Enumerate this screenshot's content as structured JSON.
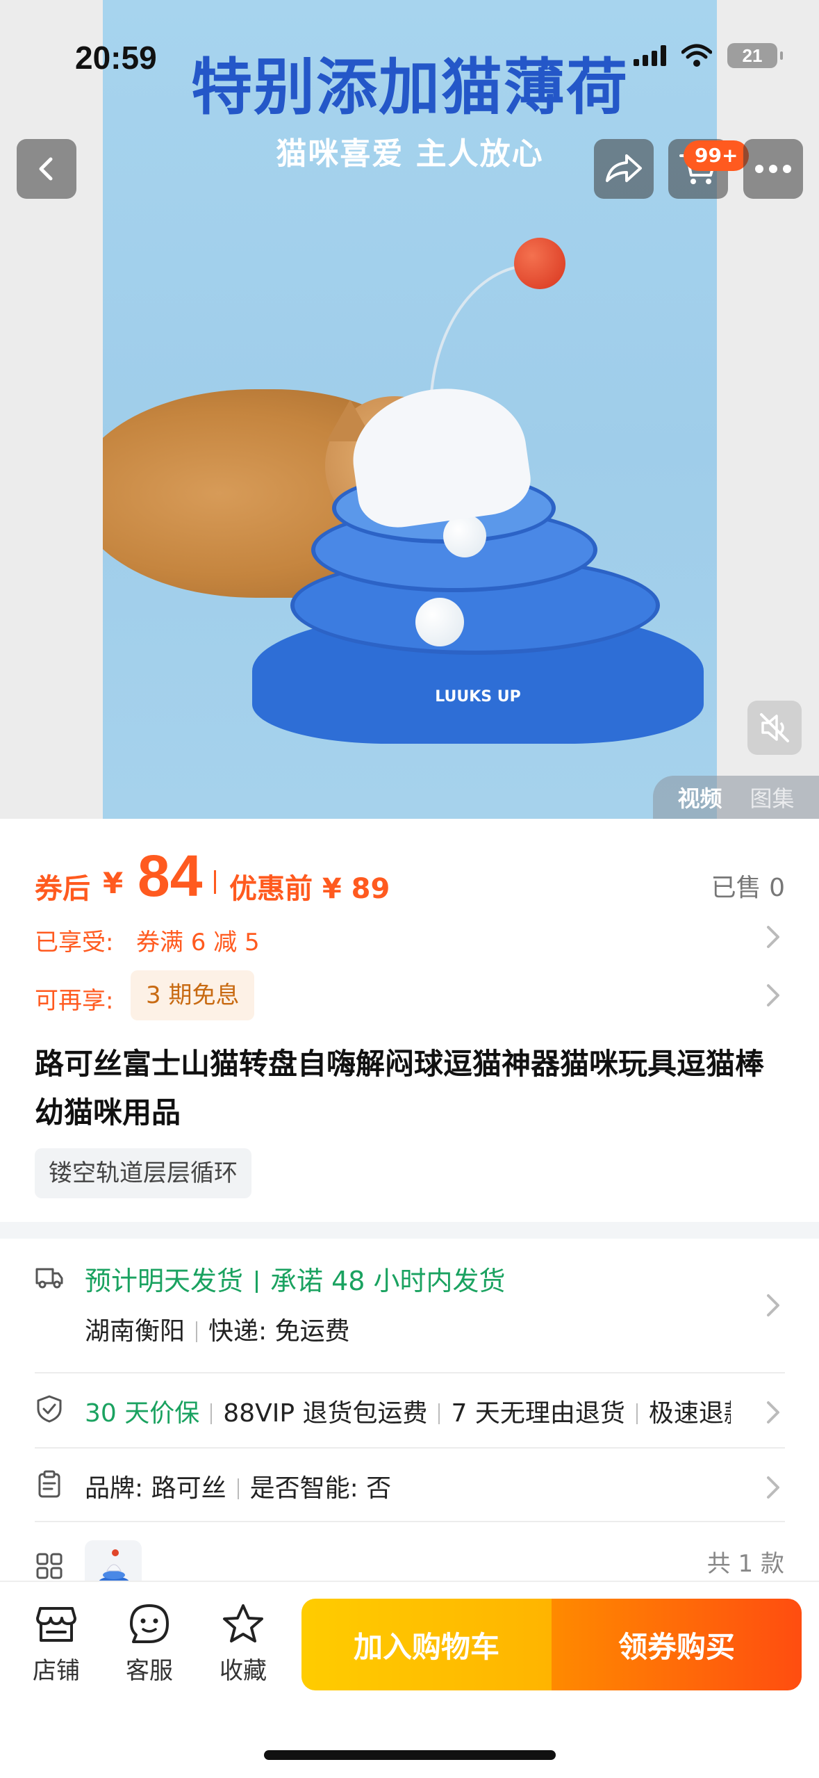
{
  "status_bar": {
    "time": "20:59",
    "battery": "21"
  },
  "hero": {
    "banner_title": "特别添加猫薄荷",
    "banner_subtitle": "猫咪喜爱 主人放心",
    "toy_brand_print": "LUUKS UP",
    "cart_badge": "99+",
    "media_tabs": [
      "视频",
      "图集"
    ],
    "active_media_tab": "视频"
  },
  "price": {
    "after_coupon_label": "券后",
    "currency": "¥",
    "after_coupon_value": "84",
    "before_label": "优惠前 ¥ 89",
    "sold": "已售 0"
  },
  "promotions": {
    "enjoyed_label": "已享受:",
    "enjoyed_value": "券满 6 减 5",
    "more_label": "可再享:",
    "more_chip": "3 期免息"
  },
  "product": {
    "title": "路可丝富士山猫转盘自嗨解闷球逗猫神器猫咪玩具逗猫棒幼猫咪用品",
    "tag": "镂空轨道层层循环"
  },
  "shipping": {
    "estimate": "预计明天发货",
    "promise": "承诺 48 小时内发货",
    "origin": "湖南衡阳",
    "express": "快递: 免运费"
  },
  "guarantees": {
    "price_protect": "30 天价保",
    "items": [
      "88VIP 退货包运费",
      "7 天无理由退货",
      "极速退款"
    ]
  },
  "params": {
    "brand": "品牌: 路可丝",
    "smart": "是否智能: 否"
  },
  "sku": {
    "count": "共 1 款"
  },
  "bottom_bar": {
    "shop": "店铺",
    "service": "客服",
    "favorite": "收藏",
    "add_to_cart": "加入购物车",
    "buy": "领券购买"
  },
  "colors": {
    "accent_orange": "#ff5a1f",
    "green": "#1aa260",
    "cart_button": "#ffb400",
    "buy_button": "#ff4d10"
  }
}
